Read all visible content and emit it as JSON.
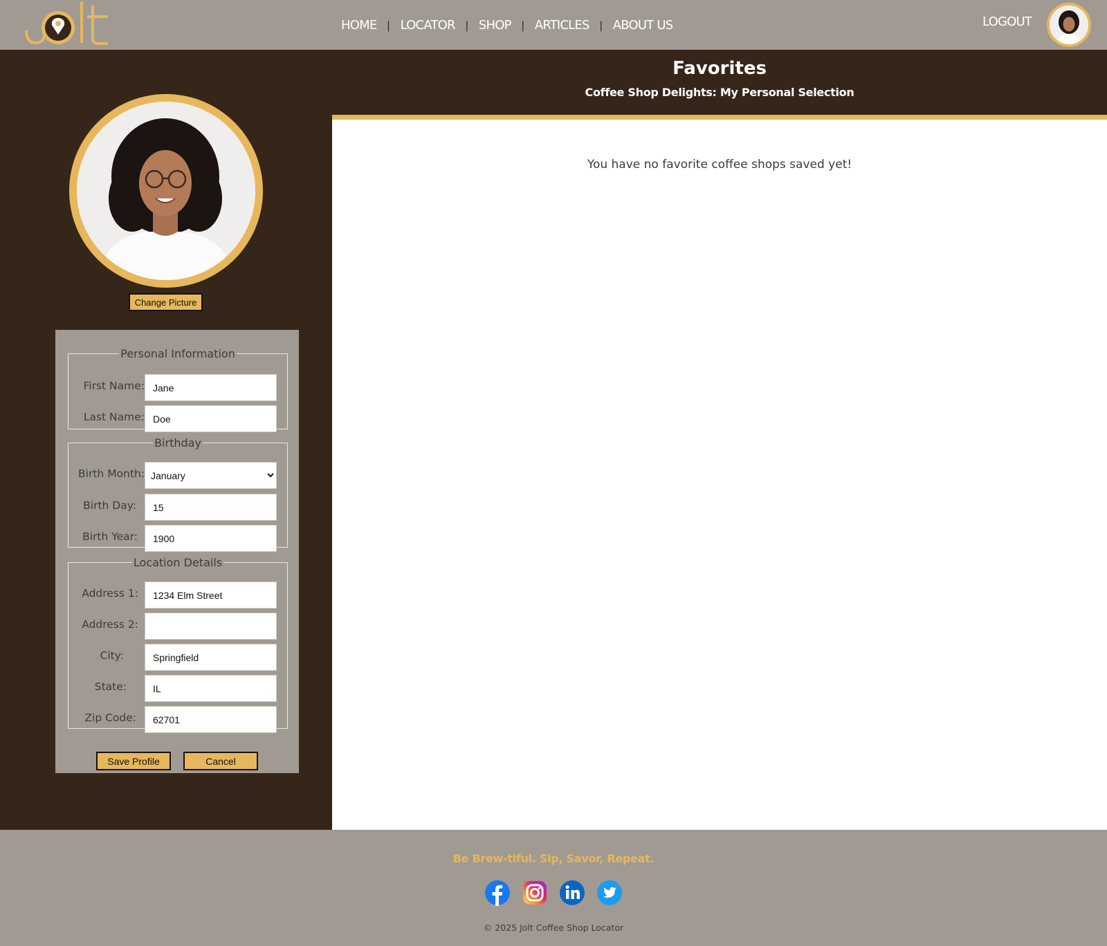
{
  "header": {
    "logo_text": "Jolt",
    "nav": [
      "HOME",
      "LOCATOR",
      "SHOP",
      "ARTICLES",
      "ABOUT US"
    ],
    "separator": "|",
    "logout_label": "LOGOUT",
    "avatar_icon": "user-avatar"
  },
  "sidebar": {
    "change_picture_label": "Change Picture",
    "personal": {
      "legend": "Personal Information",
      "first_name_label": "First Name:",
      "first_name_value": "Jane",
      "last_name_label": "Last Name:",
      "last_name_value": "Doe"
    },
    "birthday": {
      "legend": "Birthday",
      "month_label": "Birth Month:",
      "month_value": "January",
      "day_label": "Birth Day:",
      "day_value": "15",
      "year_label": "Birth Year:",
      "year_value": "1900"
    },
    "location": {
      "legend": "Location Details",
      "address1_label": "Address 1:",
      "address1_value": "1234 Elm Street",
      "address2_label": "Address 2:",
      "address2_value": "",
      "city_label": "City:",
      "city_value": "Springfield",
      "state_label": "State:",
      "state_value": "IL",
      "zip_label": "Zip Code:",
      "zip_value": "62701"
    },
    "save_label": "Save Profile",
    "cancel_label": "Cancel"
  },
  "main": {
    "title": "Favorites",
    "subtitle": "Coffee Shop Delights: My Personal Selection",
    "empty_message": "You have no favorite coffee shops saved yet!"
  },
  "footer": {
    "tagline": "Be Brew-tiful. Sip, Savor, Repeat.",
    "socials": [
      "facebook-icon",
      "instagram-icon",
      "linkedin-icon",
      "twitter-icon"
    ],
    "copyright": "© 2025 Jolt Coffee Shop Locator"
  },
  "colors": {
    "accent": "#e6b75c",
    "dark_brown": "#36261a",
    "header_gray": "#a09a92"
  }
}
